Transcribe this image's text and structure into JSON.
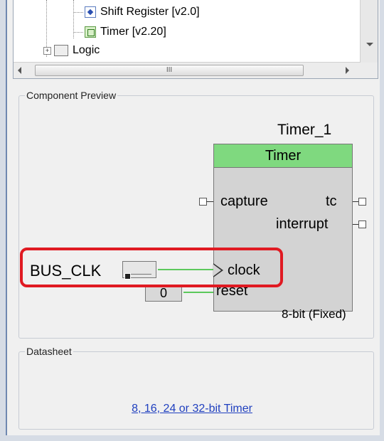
{
  "tree": {
    "items": [
      {
        "label": "Shift Register [v2.0]",
        "icon": "shift-register-icon"
      },
      {
        "label": "Timer [v2.20]",
        "icon": "timer-icon"
      },
      {
        "label": "Logic",
        "icon": "logic-icon",
        "expander": "+"
      }
    ],
    "hscroll_grip": "III"
  },
  "preview": {
    "title": "Component Preview",
    "instance_name": "Timer_1",
    "component_title": "Timer",
    "pins": {
      "capture": "capture",
      "tc": "tc",
      "interrupt": "interrupt",
      "clock": "clock",
      "reset": "reset"
    },
    "footer": "8-bit (Fixed)",
    "bus_clk_label": "BUS_CLK",
    "const_value": "0"
  },
  "datasheet": {
    "title": "Datasheet",
    "link": "8, 16, 24 or 32-bit Timer"
  },
  "colors": {
    "component_header": "#7fd97f",
    "component_body": "#d3d3d3",
    "highlight": "#e01a22",
    "link": "#1f3fbf",
    "wire": "#5cc85c"
  }
}
